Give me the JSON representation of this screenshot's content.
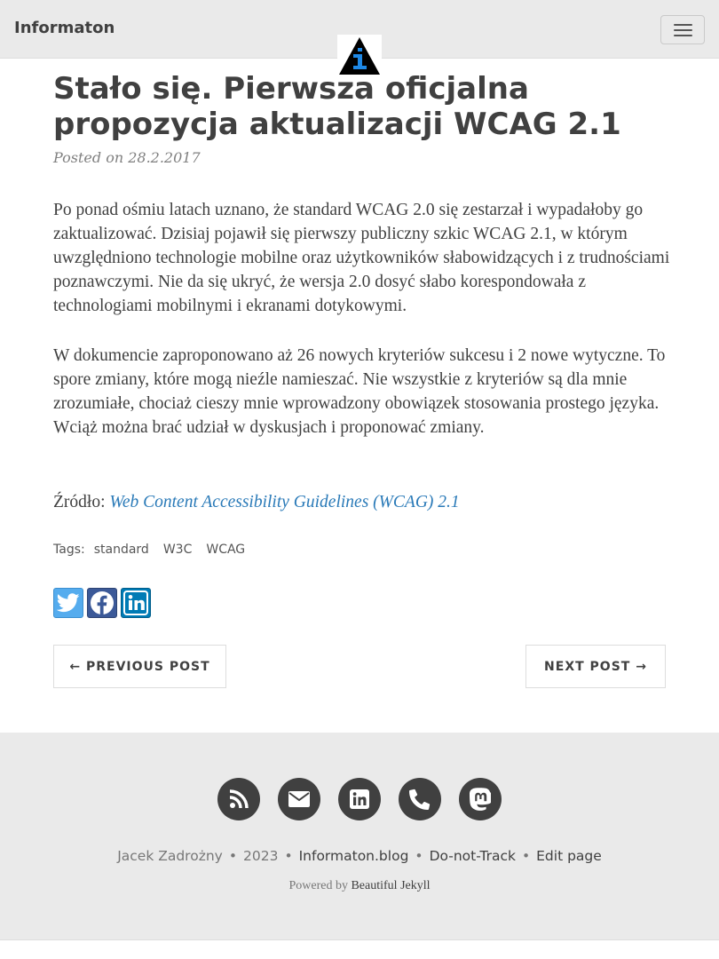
{
  "navbar": {
    "brand": "Informaton",
    "menu_icon": "hamburger-menu-icon"
  },
  "logo": {
    "icon": "information-triangle-logo",
    "colors": {
      "triangle": "#000000",
      "letter": "#1e88e5"
    }
  },
  "post": {
    "title": "Stało się. Pierwsza oficjalna propozycja aktualizacji WCAG 2.1",
    "meta": "Posted on 28.2.2017",
    "paragraphs": [
      "Po ponad ośmiu latach uznano, że standard WCAG 2.0 się zestarzał i wypadałoby go zaktualizować. Dzisiaj pojawił się pierwszy publiczny szkic WCAG 2.1, w którym uwzględniono technologie mobilne oraz użytkowników słabowidzących i z trudnościami poznawczymi. Nie da się ukryć, że wersja 2.0 dosyć słabo korespondowała z technologiami mobilnymi i ekranami dotykowymi.",
      "W dokumencie zaproponowano aż 26 nowych kryteriów sukcesu i 2 nowe wytyczne. To spore zmiany, które mogą nieźle namieszać. Nie wszystkie z kryteriów są dla mnie zrozumiałe, chociaż cieszy mnie wprowadzony obowiązek stosowania prostego języka. Wciąż można brać udział w dyskusjach i proponować zmiany."
    ],
    "source_label": "Źródło: ",
    "source_link": "Web Content Accessibility Guidelines (WCAG) 2.1"
  },
  "tags": {
    "label": "Tags:",
    "items": [
      "standard",
      "W3C",
      "WCAG"
    ]
  },
  "share": {
    "buttons": [
      {
        "icon": "twitter-icon",
        "color": "#55acee"
      },
      {
        "icon": "facebook-icon",
        "color": "#3b5998"
      },
      {
        "icon": "linkedin-icon",
        "color": "#007bb5"
      }
    ]
  },
  "pager": {
    "previous": "← PREVIOUS POST",
    "next": "NEXT POST →"
  },
  "footer": {
    "social_icons": [
      "rss-icon",
      "envelope-icon",
      "linkedin-icon",
      "phone-icon",
      "mastodon-icon"
    ],
    "author": "Jacek Zadrożny",
    "year": "2023",
    "links": [
      "Informaton.blog",
      "Do-not-Track",
      "Edit page"
    ],
    "powered_prefix": "Powered by ",
    "powered_link": "Beautiful Jekyll"
  }
}
